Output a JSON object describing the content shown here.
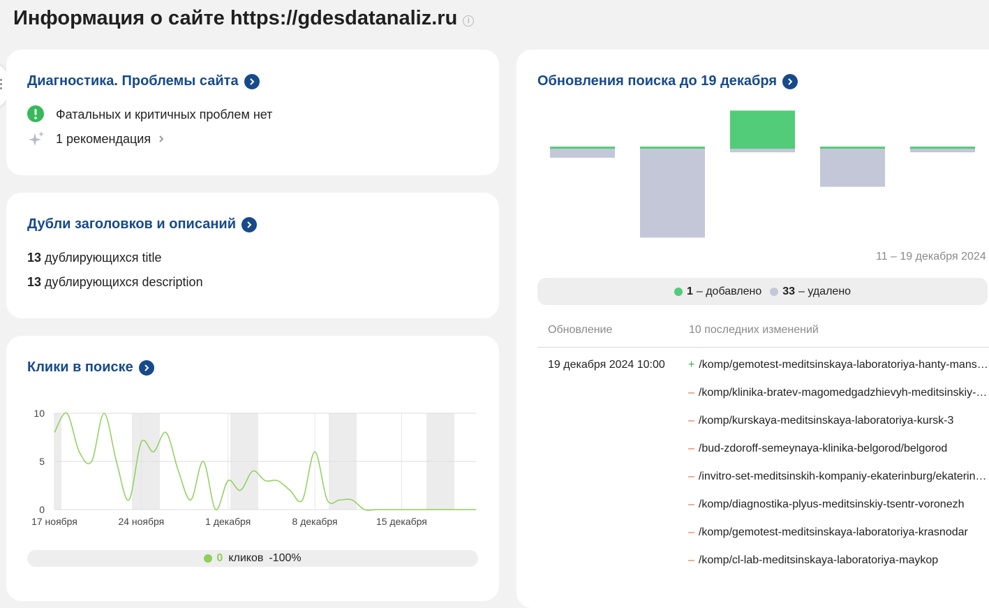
{
  "page": {
    "title": "Информация о сайте https://gdesdatanaliz.ru"
  },
  "diagnostics": {
    "title": "Диагностика. Проблемы сайта",
    "status_text": "Фатальных и критичных проблем нет",
    "recommendations_text": "1 рекомендация",
    "status_color": "#36b95a"
  },
  "duplicates": {
    "title": "Дубли заголовков и описаний",
    "title_count": "13",
    "title_label": "дублирующихся title",
    "description_count": "13",
    "description_label": "дублирующихся description"
  },
  "clicks": {
    "title": "Клики в поиске",
    "legend_value": "0",
    "legend_label": "кликов",
    "legend_change": "-100%",
    "line_color": "#8fcf5a"
  },
  "search_updates": {
    "title": "Обновления поиска до 19 декабря",
    "period": "11 – 19 декабря 2024",
    "added_count": "1",
    "added_label": "– добавлено",
    "removed_count": "33",
    "removed_label": "– удалено",
    "added_color": "#52cc79",
    "removed_color": "#c3c7d8",
    "col_update": "Обновление",
    "col_changes": "10 последних изменений",
    "update_date": "19 декабря 2024 10:00",
    "changes": [
      {
        "sign": "+",
        "path": "/komp/gemotest-meditsinskaya-laboratoriya-hanty-mansiysk"
      },
      {
        "sign": "–",
        "path": "/komp/klinika-bratev-magomedgadzhievyh-meditsinskiy-tsentr"
      },
      {
        "sign": "–",
        "path": "/komp/kurskaya-meditsinskaya-laboratoriya-kursk-3"
      },
      {
        "sign": "–",
        "path": "/bud-zdoroff-semeynaya-klinika-belgorod/belgorod"
      },
      {
        "sign": "–",
        "path": "/invitro-set-meditsinskih-kompaniy-ekaterinburg/ekaterinburg"
      },
      {
        "sign": "–",
        "path": "/komp/diagnostika-plyus-meditsinskiy-tsentr-voronezh"
      },
      {
        "sign": "–",
        "path": "/komp/gemotest-meditsinskaya-laboratoriya-krasnodar"
      },
      {
        "sign": "–",
        "path": "/komp/cl-lab-meditsinskaya-laboratoriya-maykop"
      }
    ]
  },
  "chart_data": [
    {
      "type": "line",
      "title": "Клики в поиске",
      "x_ticks": [
        "17 ноября",
        "24 ноября",
        "1 декабря",
        "8 декабря",
        "15 декабря"
      ],
      "y_ticks": [
        0,
        5,
        10
      ],
      "ylim": [
        0,
        10
      ],
      "series": [
        {
          "values": [
            8,
            10,
            6,
            5,
            10,
            5,
            1,
            7,
            6,
            8,
            4,
            1,
            5,
            0,
            3,
            2,
            4,
            3,
            3,
            2,
            1,
            6,
            1,
            1,
            1,
            0,
            0,
            0,
            0,
            0,
            0,
            0,
            0,
            0,
            0
          ]
        }
      ],
      "grid": true,
      "weekend_bands": true
    },
    {
      "type": "bar",
      "title": "Обновления поиска до 19 декабря",
      "series": [
        {
          "name": "добавлено",
          "values": [
            1,
            1,
            21,
            1,
            1
          ]
        },
        {
          "name": "удалено",
          "values": [
            5,
            49,
            2,
            21,
            2
          ]
        }
      ]
    }
  ]
}
